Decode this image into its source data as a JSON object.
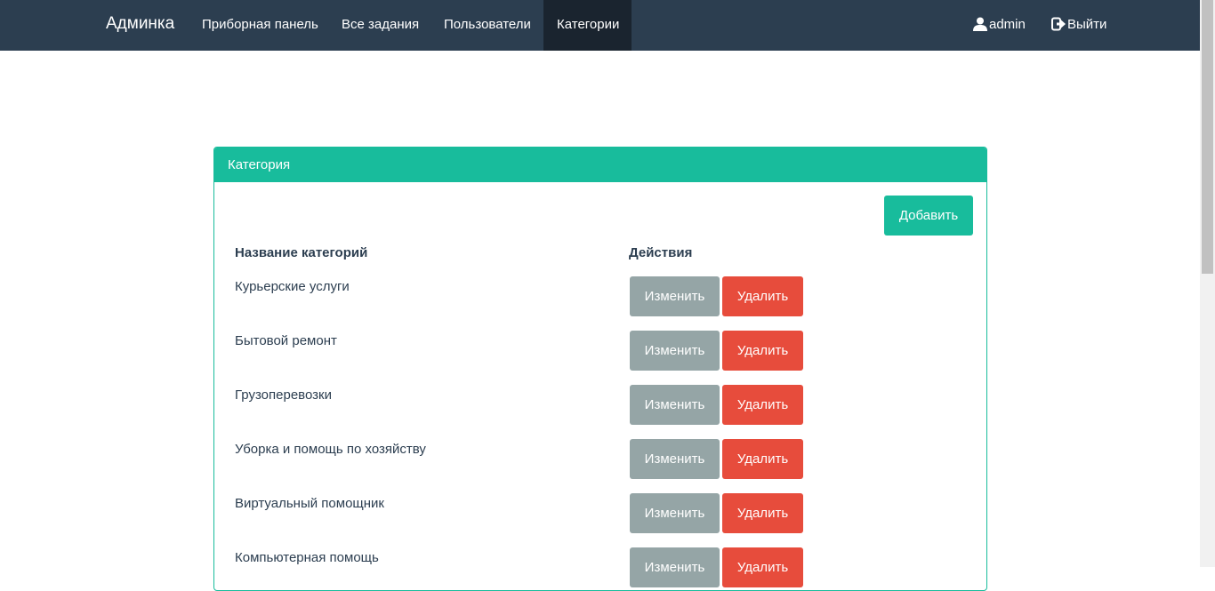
{
  "navbar": {
    "brand": "Админка",
    "items": [
      {
        "label": "Приборная панель"
      },
      {
        "label": "Все задания"
      },
      {
        "label": "Пользователи"
      },
      {
        "label": "Категории",
        "active": true
      }
    ],
    "user_label": "admin",
    "logout_label": "Выйти"
  },
  "panel": {
    "title": "Категория",
    "add_label": "Добавить",
    "columns": [
      "Название категорий",
      "Действия"
    ],
    "rows": [
      {
        "name": "Курьерские услуги",
        "edit": "Изменить",
        "delete": "Удалить"
      },
      {
        "name": "Бытовой ремонт",
        "edit": "Изменить",
        "delete": "Удалить"
      },
      {
        "name": "Грузоперевозки",
        "edit": "Изменить",
        "delete": "Удалить"
      },
      {
        "name": "Уборка и помощь по хозяйству",
        "edit": "Изменить",
        "delete": "Удалить"
      },
      {
        "name": "Виртуальный помощник",
        "edit": "Изменить",
        "delete": "Удалить"
      },
      {
        "name": "Компьютерная помощь",
        "edit": "Изменить",
        "delete": "Удалить"
      }
    ]
  },
  "colors": {
    "navbar": "#2c3e50",
    "navbar_active": "#1a242f",
    "primary": "#18bc9c",
    "edit": "#95a5a6",
    "delete": "#e74c3c"
  }
}
